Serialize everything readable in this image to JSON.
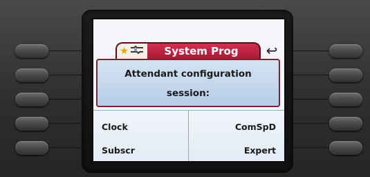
{
  "screen": {
    "title": "System Prog",
    "icons": [
      "star-icon",
      "wrench-icon",
      "back-arrow-icon"
    ],
    "message_line1": "Attendant configuration",
    "message_line2": "session:",
    "menu": {
      "left_top": "Clock",
      "right_top": "ComSpD",
      "left_bottom": "Subscr",
      "right_bottom": "Expert"
    }
  },
  "colors": {
    "title_bg": "#c0223f",
    "message_bg": "#c6d9ee",
    "screen_bg": "#f4f6f9"
  }
}
